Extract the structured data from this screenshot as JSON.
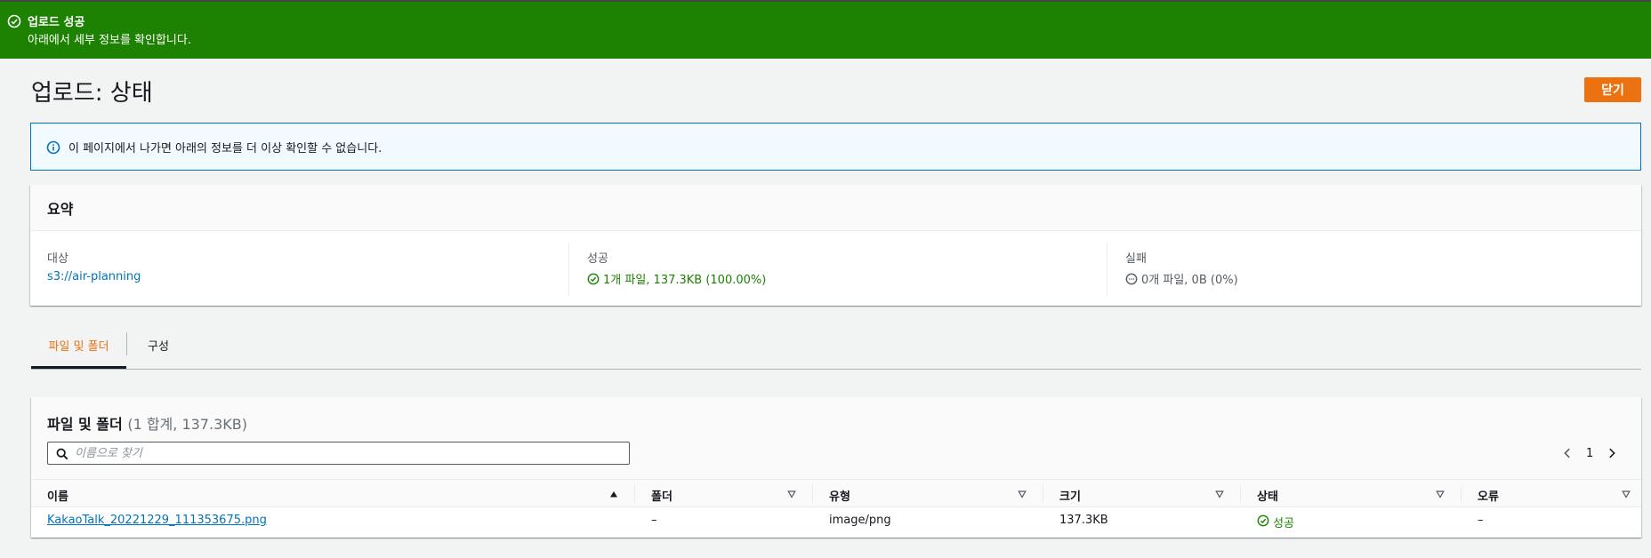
{
  "flash": {
    "title": "업로드 성공",
    "message": "아래에서 세부 정보를 확인합니다."
  },
  "page": {
    "title": "업로드: 상태",
    "close_label": "닫기"
  },
  "info_alert": {
    "text": "이 페이지에서 나가면 아래의 정보를 더 이상 확인할 수 없습니다."
  },
  "summary": {
    "title": "요약",
    "destination_label": "대상",
    "destination_value": "s3://air-planning",
    "success_label": "성공",
    "success_value": "1개 파일, 137.3KB (100.00%)",
    "failed_label": "실패",
    "failed_value": "0개 파일, 0B (0%)"
  },
  "tabs": [
    {
      "label": "파일 및 폴더",
      "active": true
    },
    {
      "label": "구성",
      "active": false
    }
  ],
  "files": {
    "title": "파일 및 폴더",
    "count": "(1 합계, 137.3KB)",
    "search_placeholder": "이름으로 찾기",
    "page_number": "1",
    "columns": [
      "이름",
      "폴더",
      "유형",
      "크기",
      "상태",
      "오류"
    ],
    "rows": [
      {
        "name": "KakaoTalk_20221229_111353675.png",
        "folder": "–",
        "type": "image/png",
        "size": "137.3KB",
        "status": "성공",
        "error": "–"
      }
    ]
  },
  "colors": {
    "flash_success": "#1d8102",
    "primary_button": "#ec7211",
    "link": "#0073bb",
    "info_border": "#0073bb",
    "info_bg": "#f1faff"
  },
  "icons": {
    "flash": "check-circle-icon",
    "info": "info-circle-icon",
    "success": "check-circle-icon",
    "failed": "minus-circle-icon",
    "search": "search-icon",
    "prev": "chevron-left-icon",
    "next": "chevron-right-icon",
    "sort_asc": "caret-up-icon",
    "sort": "caret-down-icon"
  }
}
